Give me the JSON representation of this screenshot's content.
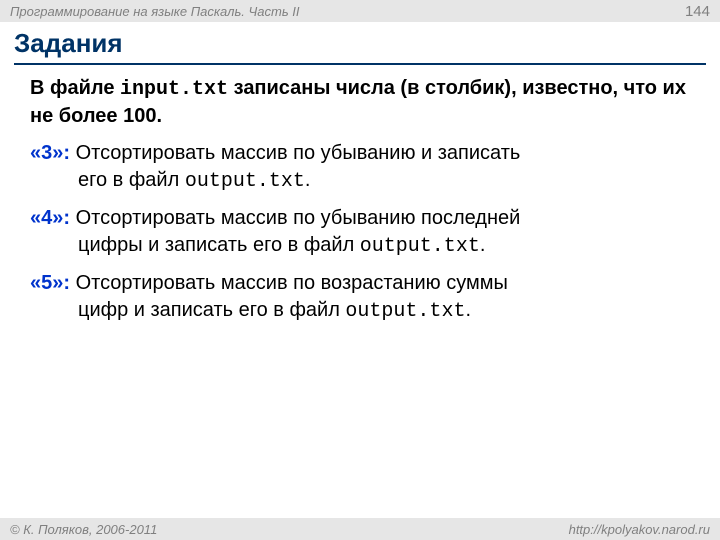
{
  "header": {
    "course": "Программирование на языке Паскаль. Часть II",
    "page": "144"
  },
  "title": "Задания",
  "intro": {
    "part1": "В файле ",
    "file": "input.txt",
    "part2": " записаны числа (в столбик), известно, что их не более 100."
  },
  "tasks": [
    {
      "label": "«3»:",
      "line1a": "  Отсортировать массив по убыванию и записать",
      "line2a": "его в файл ",
      "file": "output.txt",
      "line2b": "."
    },
    {
      "label": "«4»:",
      "line1a": "  Отсортировать массив по убыванию последней",
      "line2a": "цифры и записать его в файл ",
      "file": "output.txt",
      "line2b": "."
    },
    {
      "label": "«5»:",
      "line1a": " Отсортировать массив по возрастанию суммы",
      "line2a": "цифр и записать его в файл ",
      "file": "output.txt",
      "line2b": "."
    }
  ],
  "footer": {
    "copyright": "© К. Поляков, 2006-2011",
    "url": "http://kpolyakov.narod.ru"
  }
}
